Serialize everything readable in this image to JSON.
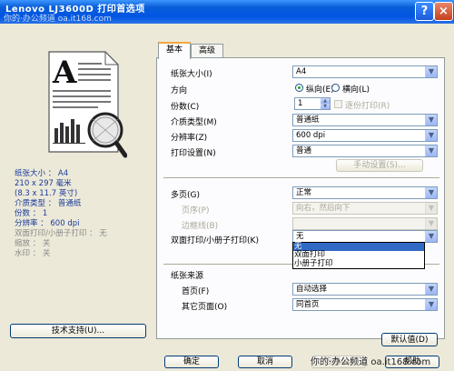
{
  "window": {
    "title": "Lenovo LJ3600D 打印首选项",
    "title_watermark": "你的·办公频道 oa.it168.com",
    "help_label": "?",
    "close_label": "×"
  },
  "summary": {
    "paper_size": "纸张大小 ： A4",
    "paper_dims": "210 x 297 毫米",
    "paper_dims_in": "(8.3 x 11.7 英寸)",
    "media_type": "介质类型 ： 普通纸",
    "copies": "份数 ： 1",
    "resolution": "分辨率 ： 600 dpi",
    "duplex": "双面打印/小册子打印 ： 无",
    "scaling": "缩放 ： 关",
    "watermark": "水印 ： 关"
  },
  "support_button": "技术支持(U)...",
  "tabs": {
    "basic": "基本",
    "advanced": "高级"
  },
  "form": {
    "paper_size_label": "纸张大小(I)",
    "paper_size_value": "A4",
    "orientation_label": "方向",
    "portrait_label": "纵向(E)",
    "landscape_label": "横向(L)",
    "copies_label": "份数(C)",
    "copies_value": "1",
    "collate_label": "逐份打印(R)",
    "media_type_label": "介质类型(M)",
    "media_type_value": "普通纸",
    "resolution_label": "分辨率(Z)",
    "resolution_value": "600 dpi",
    "print_setting_label": "打印设置(N)",
    "print_setting_value": "普通",
    "manual_settings_button": "手动设置(S)...",
    "multipage_label": "多页(G)",
    "multipage_value": "正常",
    "page_order_label": "页序(P)",
    "page_order_value": "向右，然后向下",
    "border_label": "边框线(B)",
    "border_value": "",
    "duplex_label": "双面打印/小册子打印(K)",
    "duplex_value": "无",
    "duplex_options": [
      "无",
      "双面打印",
      "小册子打印"
    ],
    "paper_source_label": "纸张来源",
    "first_page_label": "首页(F)",
    "first_page_value": "自动选择",
    "other_pages_label": "其它页面(O)",
    "other_pages_value": "同首页",
    "default_button": "默认值(D)"
  },
  "footer": {
    "ok": "确定",
    "cancel": "取消",
    "apply": "应用(A)",
    "help": "帮助",
    "watermark": "你的·办公频道 oa.it168.com"
  }
}
